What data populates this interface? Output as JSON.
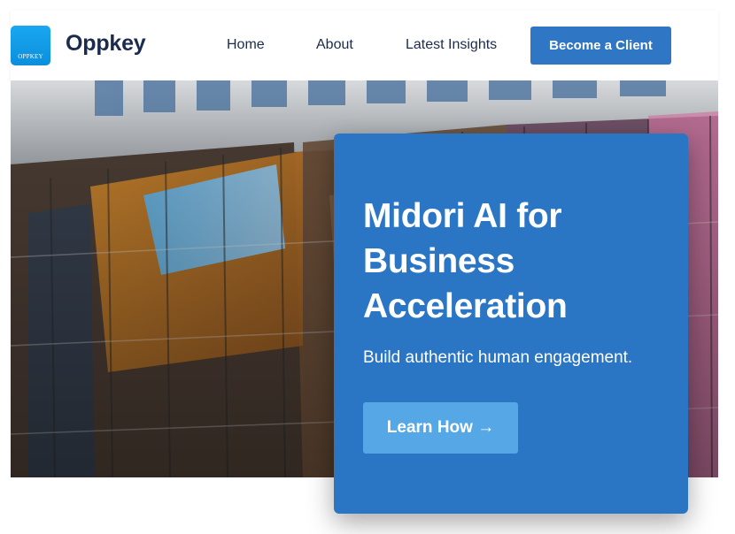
{
  "header": {
    "logo_badge_text": "OPPKEY",
    "logo_name": "Oppkey",
    "nav": {
      "home": "Home",
      "about": "About",
      "insights": "Latest Insights"
    },
    "cta_label": "Become a Client"
  },
  "hero": {
    "title": "Midori AI for Business Acceleration",
    "subtitle": "Build authentic human engagement.",
    "button_label": "Learn How →"
  },
  "colors": {
    "brand_blue": "#2f76c5",
    "card_blue": "#2a75c4",
    "button_light_blue": "#56a7e6",
    "nav_text": "#1b2b4d"
  }
}
